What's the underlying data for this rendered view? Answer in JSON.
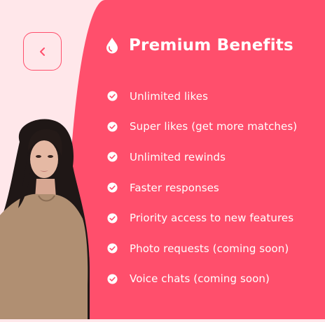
{
  "header": {
    "title": "Premium Benefits",
    "icon": "drop-icon",
    "back_icon": "chevron-left-icon"
  },
  "benefits": [
    {
      "label": "Unlimited likes",
      "icon": "check-circle-icon"
    },
    {
      "label": "Super likes (get more matches)",
      "icon": "check-circle-icon"
    },
    {
      "label": "Unlimited rewinds",
      "icon": "check-circle-icon"
    },
    {
      "label": "Faster responses",
      "icon": "check-circle-icon"
    },
    {
      "label": "Priority access to new features",
      "icon": "check-circle-icon"
    },
    {
      "label": "Photo requests (coming soon)",
      "icon": "check-circle-icon"
    },
    {
      "label": "Voice chats (coming soon)",
      "icon": "check-circle-icon"
    }
  ],
  "colors": {
    "accent": "#FF4F6C",
    "left_background": "#FFE7EA",
    "text": "#FFFFFF"
  }
}
